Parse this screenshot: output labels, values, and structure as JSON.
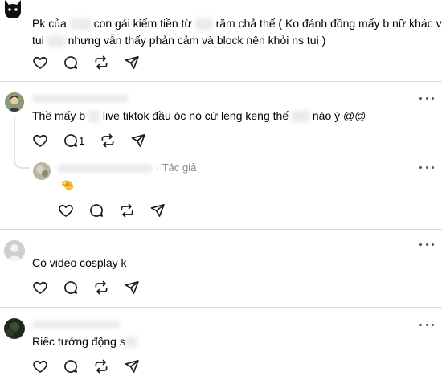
{
  "comments": [
    {
      "text_before": "Pk của ",
      "text_mid1": "con gái kiếm tiền từ ",
      "text_mid2": "răm chả thế ( Ko đánh đồng mấy b nữ khác và",
      "line2_before": "tui ",
      "line2_after": "nhưng vẫn thấy phản cảm và block nên khỏi ns tui )"
    },
    {
      "text_before": "Thề mấy b",
      "text_mid": "live tiktok đầu óc nó cứ leng keng thế",
      "text_after": "nào ý @@",
      "reply_count": "1"
    },
    {
      "reply_meta": "· Tác giả",
      "reply_emoji": "🤏"
    },
    {
      "text": "Có video cosplay k"
    },
    {
      "text": "Riếc tưởng động s"
    }
  ],
  "icons": {
    "like": "heart-icon",
    "reply": "comment-icon",
    "repost": "repost-icon",
    "share": "send-icon",
    "more": "more-icon"
  },
  "colors": {
    "icon": "#1c1c1c",
    "divider": "#dbdbdb",
    "meta": "#8a8a8a"
  }
}
